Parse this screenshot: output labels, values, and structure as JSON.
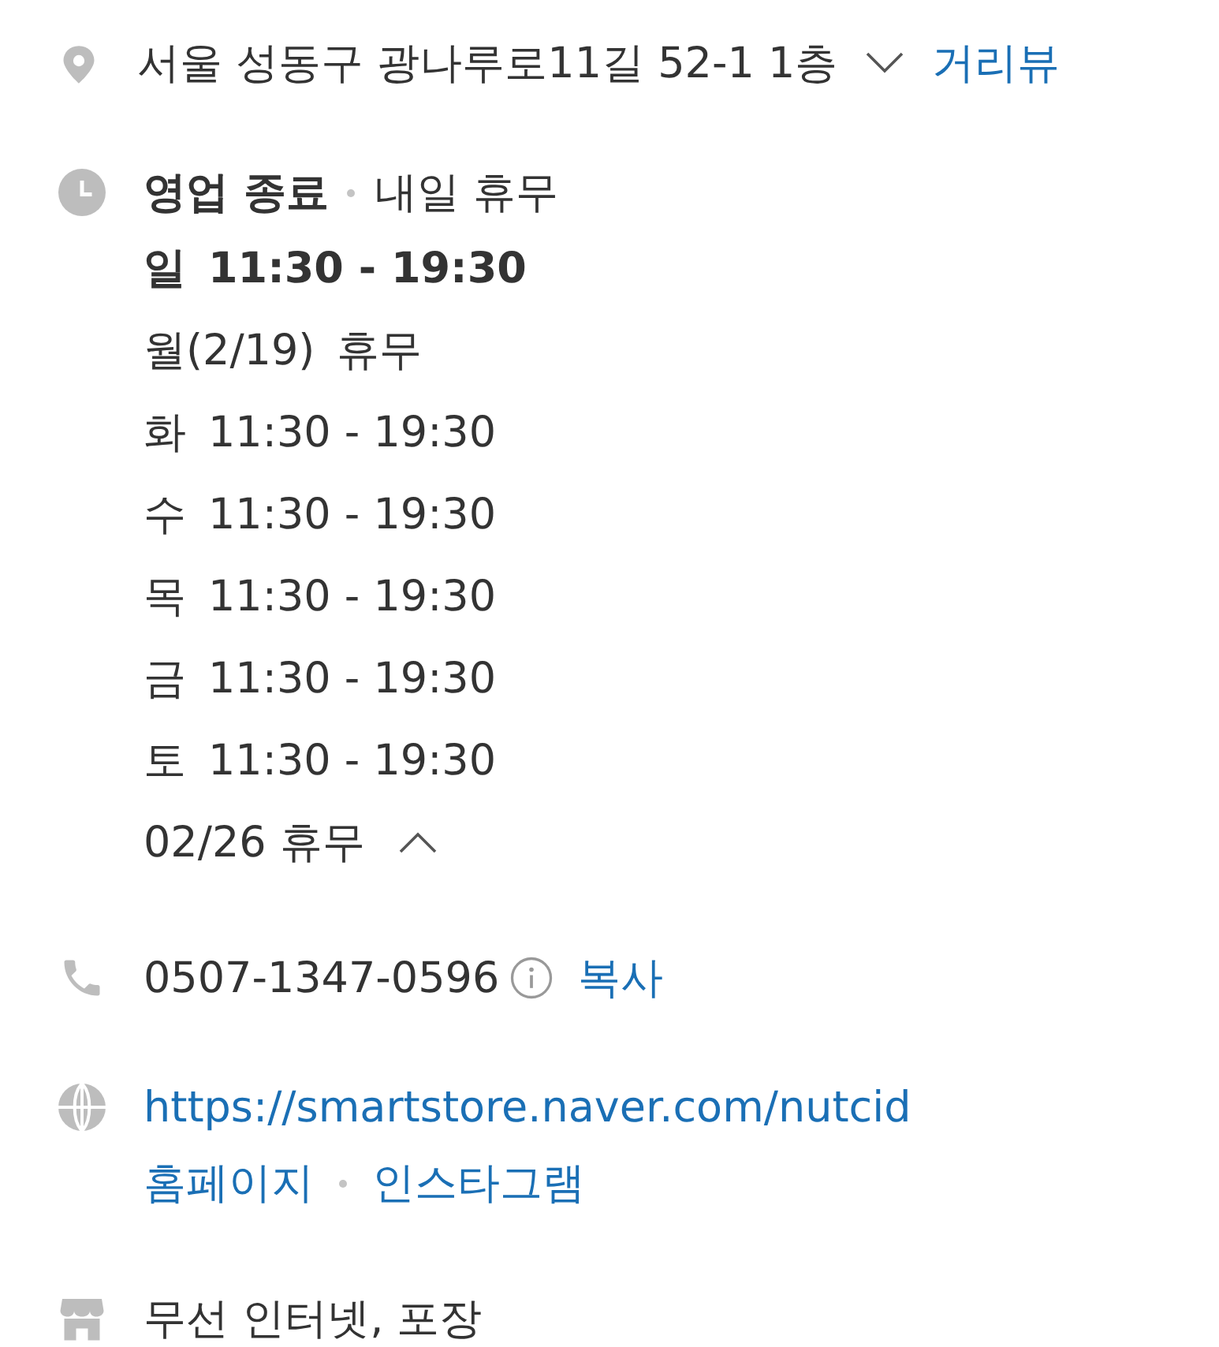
{
  "address": {
    "text": "서울 성동구 광나루로11길 52-1 1층",
    "expanded": false,
    "link": "거리뷰"
  },
  "hours": {
    "status": "영업 종료",
    "note": "내일 휴무",
    "expanded": true,
    "days": [
      {
        "day": "일",
        "time": "11:30 - 19:30",
        "today": true
      },
      {
        "day": "월(2/19)",
        "time": "휴무",
        "today": false
      },
      {
        "day": "화",
        "time": "11:30 - 19:30",
        "today": false
      },
      {
        "day": "수",
        "time": "11:30 - 19:30",
        "today": false
      },
      {
        "day": "목",
        "time": "11:30 - 19:30",
        "today": false
      },
      {
        "day": "금",
        "time": "11:30 - 19:30",
        "today": false
      },
      {
        "day": "토",
        "time": "11:30 - 19:30",
        "today": false
      }
    ],
    "footer": "02/26 휴무"
  },
  "phone": {
    "number": "0507-1347-0596",
    "copy": "복사"
  },
  "website": {
    "url": "https://smartstore.naver.com/nutcid",
    "links": [
      "홈페이지",
      "인스타그램"
    ]
  },
  "amenities": "무선 인터넷, 포장"
}
